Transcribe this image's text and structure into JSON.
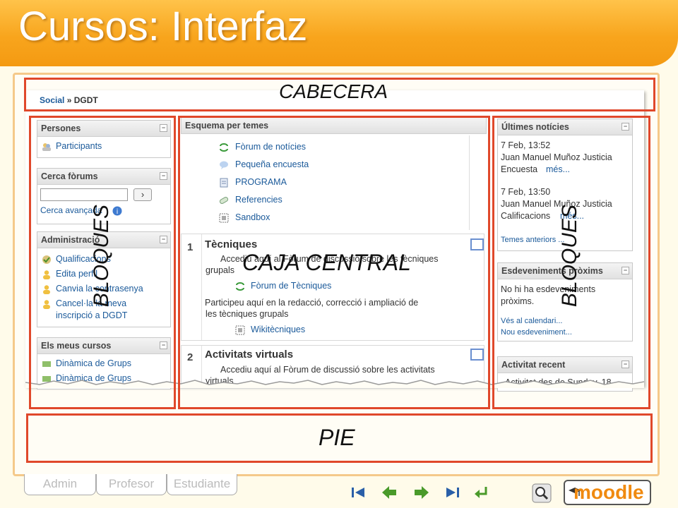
{
  "slide": {
    "title": "Cursos: Interfaz"
  },
  "breadcrumb": {
    "home": "Social",
    "separator": "»",
    "current": "DGDT"
  },
  "blocks_left": {
    "persones": {
      "title": "Persones",
      "participants": "Participants"
    },
    "cerca": {
      "title": "Cerca fòrums",
      "input_value": "",
      "go": "›",
      "advanced": "Cerca avançada"
    },
    "admin": {
      "title": "Administració",
      "items": [
        "Qualificacions",
        "Edita perfil",
        "Canvia la contrasenya",
        "Cancel·la la meva",
        "inscripció a DGDT"
      ]
    },
    "cursos": {
      "title": "Els meus cursos",
      "items": [
        "Dinàmica de Grups",
        "Dinàmica de Grups"
      ]
    }
  },
  "central": {
    "title": "Esquema per temes",
    "top_items": [
      "Fòrum de notícies",
      "Pequeña encuesta",
      "PROGRAMA",
      "Referencies",
      "Sandbox"
    ],
    "sec1": {
      "num": "1",
      "title": "Tècniques",
      "desc1": "Accediu aquí al Fòrum de discussió sobre les tècniques",
      "desc2": "grupals",
      "forum": "Fòrum de Tècniques",
      "desc3": "Participeu aquí en la redacció, correcció i ampliació de",
      "desc4": "les tècniques grupals",
      "wiki": "Wikitècniques"
    },
    "sec2": {
      "num": "2",
      "title": "Activitats virtuals",
      "desc1": "Accediu aquí al Fòrum de discussió sobre les activitats",
      "desc2": "virtuals"
    }
  },
  "blocks_right": {
    "news": {
      "title": "Últimes notícies",
      "d1": "7 Feb, 13:52",
      "a1": "Juan Manuel Muñoz Justicia",
      "t1": "Encuesta",
      "more1": "més...",
      "d2": "7 Feb, 13:50",
      "a2": "Juan Manuel Muñoz Justicia",
      "t2": "Calificacions",
      "more2": "més...",
      "older": "Temes anteriors ..."
    },
    "events": {
      "title": "Esdeveniments pròxims",
      "none1": "No hi ha esdeveniments",
      "none2": "pròxims.",
      "calendar": "Vés al calendari...",
      "new": "Nou esdeveniment..."
    },
    "recent": {
      "title": "Activitat recent",
      "since": "Activitat des de Sunday, 18"
    }
  },
  "annotations": {
    "header": "CABECERA",
    "center": "CAJA CENTRAL",
    "left": "BLOQUES",
    "right": "BLOQUES",
    "footer": "PIE"
  },
  "tabs": [
    "Admin",
    "Profesor",
    "Estudiante"
  ],
  "logo": {
    "text": "moodle"
  },
  "colors": {
    "banner": "#f8a51d",
    "annotation": "#e0482b",
    "link": "#1b5a9a",
    "nav_arrow": "#4a9a2a"
  }
}
